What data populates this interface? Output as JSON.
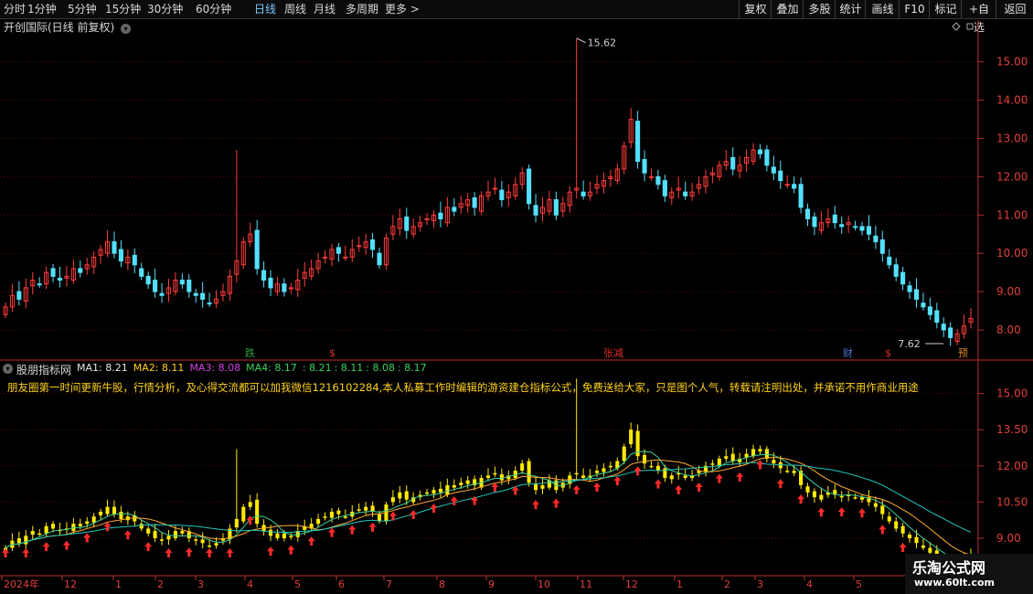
{
  "toolbar": {
    "periods": [
      "分时",
      "1分钟",
      "5分钟",
      "15分钟",
      "30分钟",
      "60分钟",
      "日线",
      "周线",
      "月线",
      "多周期",
      "更多"
    ],
    "active_period": "日线",
    "right_buttons": [
      "复权",
      "叠加",
      "多股",
      "统计",
      "画线",
      "F10",
      "标记",
      "+自选",
      "返回"
    ]
  },
  "main_panel": {
    "title": "开创国际(日线 前复权)",
    "axis_ticks": [
      "15.00",
      "14.00",
      "13.00",
      "12.00",
      "11.00",
      "10.00",
      "9.00",
      "8.00"
    ],
    "max_label": "15.62",
    "min_label": "7.62",
    "event_markers": [
      {
        "text": "跌",
        "color": "#2ea043"
      },
      {
        "text": "$",
        "color": "#e0302a"
      },
      {
        "text": "张减",
        "color": "#e0302a"
      },
      {
        "text": "财",
        "color": "#4a78d8"
      },
      {
        "text": "$",
        "color": "#e0302a"
      },
      {
        "text": "预",
        "color": "#d98a2a"
      }
    ]
  },
  "indicator_panel": {
    "name": "股朋指标网",
    "ma": [
      {
        "label": "MA1: 8.21",
        "color": "#e6e6e6"
      },
      {
        "label": "MA2: 8.11",
        "color": "#ffd21a"
      },
      {
        "label": "MA3: 8.08",
        "color": "#d040e0"
      },
      {
        "label": "MA4: 8.17",
        "color": "#3cd060"
      },
      {
        "label": ": 8.21",
        "color": "#3cd060"
      },
      {
        "label": ": 8.11",
        "color": "#3cd060"
      },
      {
        "label": ": 8.08",
        "color": "#3cd060"
      },
      {
        "label": ": 8.17",
        "color": "#3cd060"
      }
    ],
    "text": "朋友圈第一时间更新牛股，行情分析，及心得交流都可以加我微信1216102284,本人私募工作时编辑的游资建仓指标公式，免费送给大家，只是图个人气，转载请注明出处，并承诺不用作商业用途",
    "axis_ticks": [
      "15.00",
      "13.50",
      "12.00",
      "10.50",
      "9.00"
    ]
  },
  "time_axis": [
    "2024年",
    "12",
    "1",
    "2",
    "3",
    "4",
    "5",
    "6",
    "7",
    "8",
    "9",
    "10",
    "11",
    "12",
    "1",
    "2",
    "3",
    "4",
    "5"
  ],
  "watermark": {
    "title": "乐淘公式网",
    "url": "www.60lt.com"
  },
  "colors": {
    "up": "#ff3c3c",
    "down": "#54e0ff",
    "grid": "#5a0f0f",
    "axis": "#c0302a",
    "ind_candle": "#ffea00",
    "arrow": "#ff2a2a"
  },
  "chart_data": {
    "type": "candlestick",
    "title": "开创国际(日线 前复权)",
    "y_range": [
      7.3,
      15.9
    ],
    "closes": [
      8.6,
      8.9,
      8.8,
      9.1,
      9.3,
      9.2,
      9.5,
      9.4,
      9.3,
      9.4,
      9.6,
      9.5,
      9.7,
      9.9,
      10.1,
      10.3,
      10.0,
      9.8,
      9.9,
      9.7,
      9.4,
      9.2,
      9.0,
      8.9,
      9.1,
      9.3,
      9.2,
      9.0,
      8.9,
      8.8,
      8.7,
      8.8,
      9.0,
      9.4,
      9.8,
      10.3,
      10.5,
      9.6,
      9.3,
      9.1,
      9.2,
      9.0,
      9.1,
      9.3,
      9.5,
      9.6,
      9.8,
      9.9,
      10.1,
      10.0,
      9.9,
      10.1,
      10.2,
      10.3,
      10.1,
      9.7,
      10.4,
      10.7,
      10.9,
      10.6,
      10.7,
      10.8,
      10.9,
      11.0,
      10.9,
      11.2,
      11.1,
      11.3,
      11.4,
      11.2,
      11.5,
      11.6,
      11.7,
      11.4,
      11.6,
      11.8,
      12.1,
      11.3,
      11.0,
      11.2,
      11.4,
      11.0,
      11.3,
      11.6,
      11.7,
      11.5,
      11.6,
      11.8,
      11.9,
      12.0,
      12.2,
      12.8,
      13.5,
      12.4,
      12.1,
      12.0,
      11.8,
      11.5,
      11.6,
      11.7,
      11.5,
      11.6,
      11.8,
      12.0,
      12.1,
      12.3,
      12.4,
      12.2,
      12.3,
      12.5,
      12.7,
      12.6,
      12.3,
      12.1,
      11.9,
      11.8,
      11.7,
      11.2,
      10.9,
      10.7,
      10.8,
      10.9,
      10.8,
      10.7,
      10.8,
      10.7,
      10.6,
      10.5,
      10.3,
      10.0,
      9.7,
      9.4,
      9.2,
      9.0,
      8.8,
      8.6,
      8.4,
      8.2,
      8.0,
      7.8,
      7.9,
      8.1,
      8.3
    ]
  }
}
